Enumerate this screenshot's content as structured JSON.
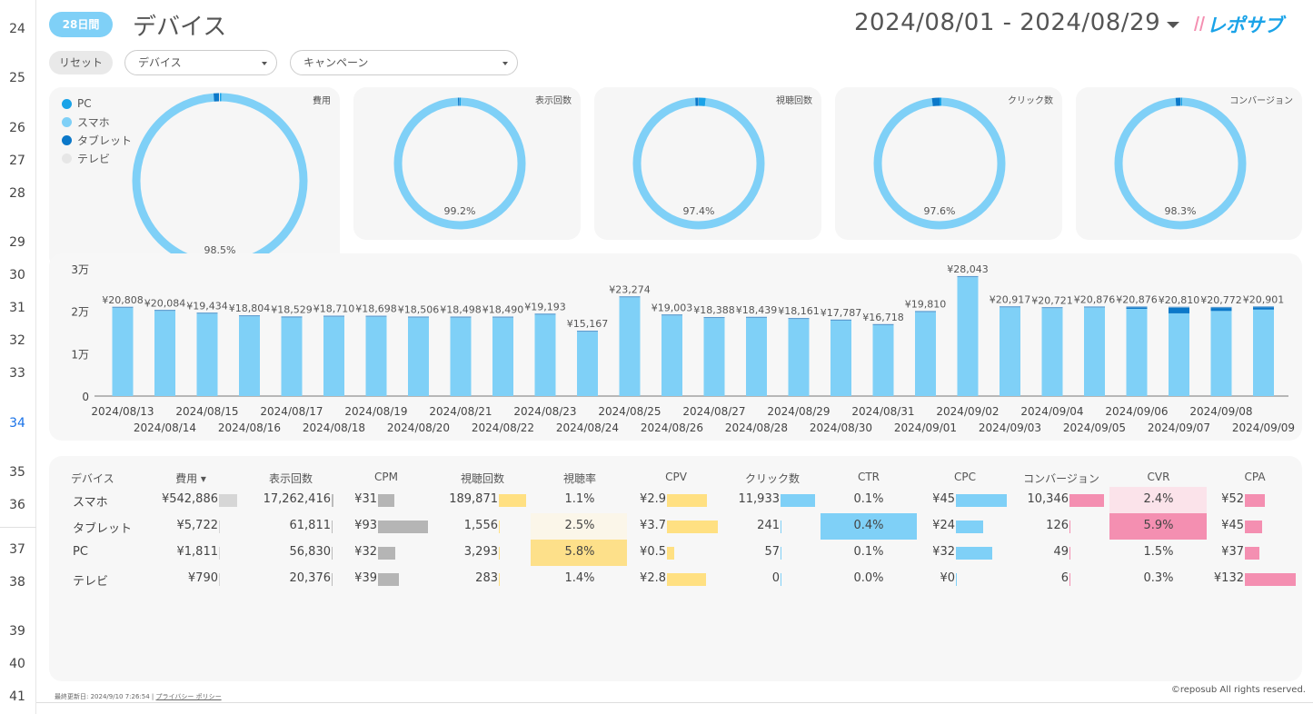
{
  "gutter_rows": [
    {
      "n": "24",
      "top": 24
    },
    {
      "n": "25",
      "top": 78
    },
    {
      "n": "26",
      "top": 133
    },
    {
      "n": "27",
      "top": 169
    },
    {
      "n": "28",
      "top": 205
    },
    {
      "n": "29",
      "top": 259
    },
    {
      "n": "30",
      "top": 295
    },
    {
      "n": "31",
      "top": 331
    },
    {
      "n": "32",
      "top": 367
    },
    {
      "n": "33",
      "top": 403
    },
    {
      "n": "34",
      "top": 458
    },
    {
      "n": "35",
      "top": 512
    },
    {
      "n": "36",
      "top": 548
    },
    {
      "n": "37",
      "top": 597
    },
    {
      "n": "38",
      "top": 633
    },
    {
      "n": "39",
      "top": 687
    },
    {
      "n": "40",
      "top": 723
    },
    {
      "n": "41",
      "top": 759
    }
  ],
  "header": {
    "period_pill": "28日間",
    "title": "デバイス",
    "date_range": "2024/08/01 - 2024/08/29",
    "logo_text": "レポサブ"
  },
  "filters": {
    "reset": "リセット",
    "device": "デバイス",
    "campaign": "キャンペーン"
  },
  "legend": [
    {
      "label": "PC",
      "color": "#1aa3e8"
    },
    {
      "label": "スマホ",
      "color": "#7fd0f7"
    },
    {
      "label": "タブレット",
      "color": "#0b78c9"
    },
    {
      "label": "テレビ",
      "color": "#e6e6e6"
    }
  ],
  "donuts": [
    {
      "label": "費用",
      "pct": "98.5%",
      "values": {
        "PC": 0.3,
        "スマホ": 98.5,
        "タブレット": 1.0,
        "テレビ": 0.2
      }
    },
    {
      "label": "表示回数",
      "pct": "99.2%",
      "values": {
        "PC": 0.3,
        "スマホ": 99.2,
        "タブレット": 0.4,
        "テレビ": 0.1
      }
    },
    {
      "label": "視聴回数",
      "pct": "97.4%",
      "values": {
        "PC": 1.7,
        "スマホ": 97.4,
        "タブレット": 0.8,
        "テレビ": 0.1
      }
    },
    {
      "label": "クリック数",
      "pct": "97.6%",
      "values": {
        "PC": 0.5,
        "スマホ": 97.6,
        "タブレット": 1.9,
        "テレビ": 0.0
      }
    },
    {
      "label": "コンバージョン",
      "pct": "98.3%",
      "values": {
        "PC": 0.5,
        "スマホ": 98.3,
        "タブレット": 1.2,
        "テレビ": 0.1
      }
    }
  ],
  "chart_data": {
    "type": "bar",
    "ylim": [
      0,
      30000
    ],
    "yticks": [
      {
        "v": 0,
        "label": "0"
      },
      {
        "v": 10000,
        "label": "1万"
      },
      {
        "v": 20000,
        "label": "2万"
      },
      {
        "v": 30000,
        "label": "3万"
      }
    ],
    "categories": [
      "2024/08/13",
      "2024/08/14",
      "2024/08/15",
      "2024/08/16",
      "2024/08/17",
      "2024/08/18",
      "2024/08/19",
      "2024/08/20",
      "2024/08/21",
      "2024/08/22",
      "2024/08/23",
      "2024/08/24",
      "2024/08/25",
      "2024/08/26",
      "2024/08/27",
      "2024/08/28",
      "2024/08/29",
      "2024/08/30",
      "2024/08/31",
      "2024/09/01",
      "2024/09/02",
      "2024/09/03",
      "2024/09/04",
      "2024/09/05",
      "2024/09/06",
      "2024/09/07",
      "2024/09/08",
      "2024/09/09"
    ],
    "totals": [
      20808,
      20084,
      19434,
      18804,
      18529,
      18710,
      18698,
      18506,
      18498,
      18490,
      19193,
      15167,
      23274,
      19003,
      18388,
      18439,
      18161,
      17787,
      16718,
      19810,
      28043,
      20917,
      20721,
      20876,
      20876,
      20810,
      20772,
      20901
    ],
    "labels": [
      "¥20,808",
      "¥20,084",
      "¥19,434",
      "¥18,804",
      "¥18,529",
      "¥18,710",
      "¥18,698",
      "¥18,506",
      "¥18,498",
      "¥18,490",
      "¥19,193",
      "¥15,167",
      "¥23,274",
      "¥19,003",
      "¥18,388",
      "¥18,439",
      "¥18,161",
      "¥17,787",
      "¥16,718",
      "¥19,810",
      "¥28,043",
      "¥20,917",
      "¥20,721",
      "¥20,876",
      "¥20,876",
      "¥20,810",
      "¥20,772",
      "¥20,901"
    ],
    "tablet": [
      0,
      0,
      0,
      0,
      0,
      0,
      0,
      0,
      0,
      0,
      0,
      0,
      0,
      0,
      0,
      0,
      0,
      0,
      0,
      0,
      0,
      0,
      0,
      0,
      300,
      1300,
      700,
      500
    ],
    "colors": {
      "smartphone": "#7fd0f7",
      "tablet": "#0b78c9",
      "pc": "#1aa3e8"
    }
  },
  "table": {
    "headers": [
      "デバイス",
      "費用 ▾",
      "表示回数",
      "CPM",
      "視聴回数",
      "視聴率",
      "CPV",
      "クリック数",
      "CTR",
      "CPC",
      "コンバージョン",
      "CVR",
      "CPA"
    ],
    "rows": [
      {
        "device": "スマホ",
        "cost": "¥542,886",
        "imp": "17,262,416",
        "cpm": "¥31",
        "views": "189,871",
        "vr": "1.1%",
        "cpv": "¥2.9",
        "clicks": "11,933",
        "ctr": "0.1%",
        "cpc": "¥45",
        "cv": "10,346",
        "cvr": "2.4%",
        "cpa": "¥52"
      },
      {
        "device": "タブレット",
        "cost": "¥5,722",
        "imp": "61,811",
        "cpm": "¥93",
        "views": "1,556",
        "vr": "2.5%",
        "cpv": "¥3.7",
        "clicks": "241",
        "ctr": "0.4%",
        "cpc": "¥24",
        "cv": "126",
        "cvr": "5.9%",
        "cpa": "¥45"
      },
      {
        "device": "PC",
        "cost": "¥1,811",
        "imp": "56,830",
        "cpm": "¥32",
        "views": "3,293",
        "vr": "5.8%",
        "cpv": "¥0.5",
        "clicks": "57",
        "ctr": "0.1%",
        "cpc": "¥32",
        "cv": "49",
        "cvr": "1.5%",
        "cpa": "¥37"
      },
      {
        "device": "テレビ",
        "cost": "¥790",
        "imp": "20,376",
        "cpm": "¥39",
        "views": "283",
        "vr": "1.4%",
        "cpv": "¥2.8",
        "clicks": "0",
        "ctr": "0.0%",
        "cpc": "¥0",
        "cv": "6",
        "cvr": "0.3%",
        "cpa": "¥132"
      }
    ]
  },
  "footer": {
    "updated": "最終更新日: 2024/9/10 7:26:54",
    "privacy": "プライバシー ポリシー",
    "copyright": "©reposub All rights reserved."
  }
}
